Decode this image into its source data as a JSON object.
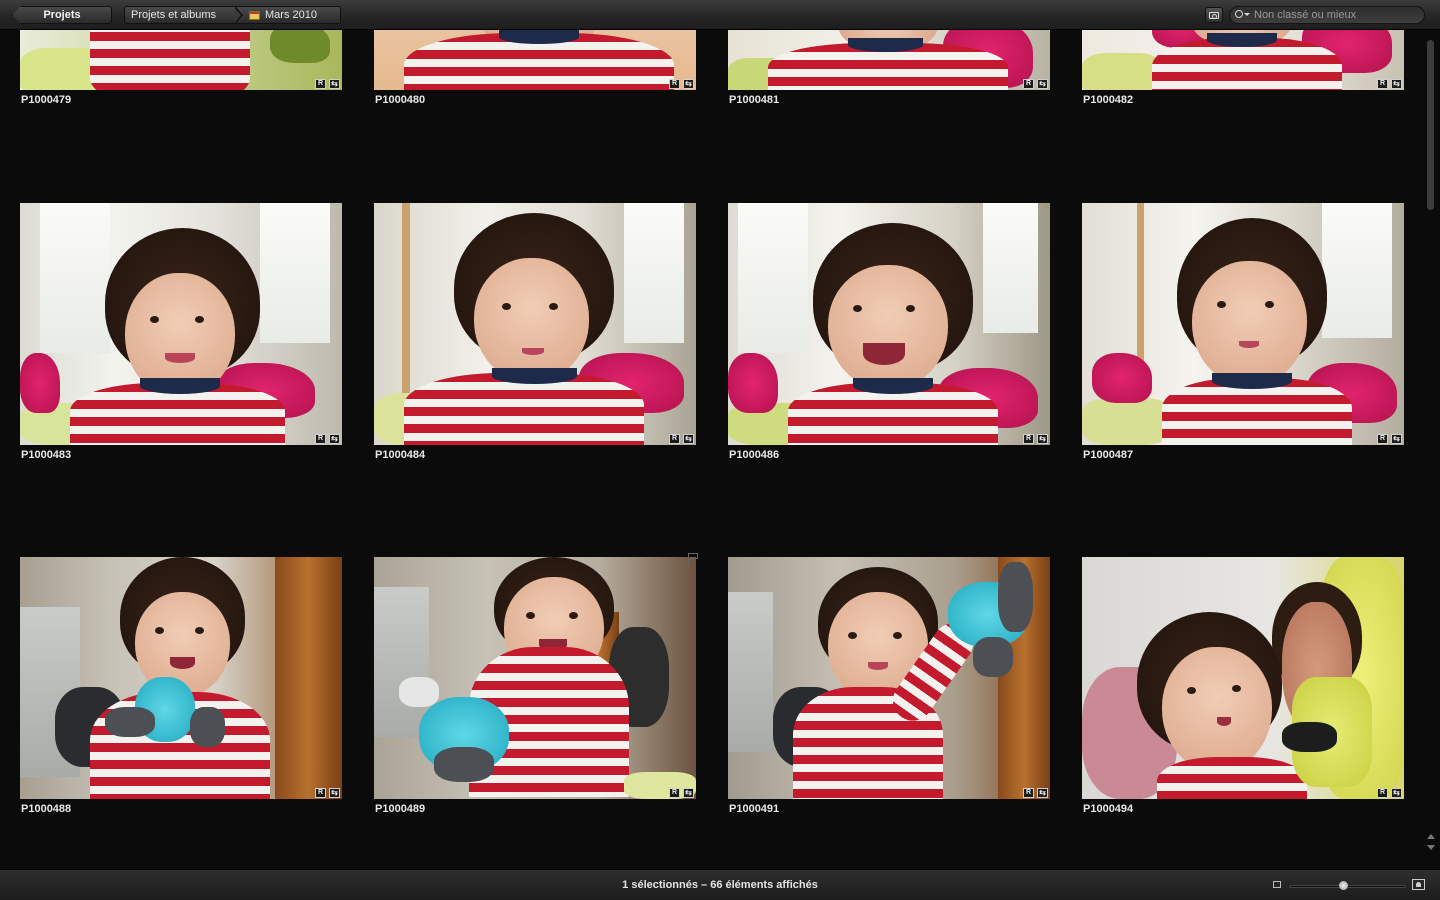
{
  "toolbar": {
    "back_label": "Projets",
    "breadcrumb": [
      "Projets et albums",
      "Mars 2010"
    ],
    "search_placeholder": "Non classé ou mieux"
  },
  "badges": {
    "raw": "R",
    "adjust": "⇆"
  },
  "photos": [
    {
      "name": "P1000479"
    },
    {
      "name": "P1000480"
    },
    {
      "name": "P1000481"
    },
    {
      "name": "P1000482"
    },
    {
      "name": "P1000483"
    },
    {
      "name": "P1000484"
    },
    {
      "name": "P1000486"
    },
    {
      "name": "P1000487"
    },
    {
      "name": "P1000488"
    },
    {
      "name": "P1000489"
    },
    {
      "name": "P1000491"
    },
    {
      "name": "P1000494"
    }
  ],
  "status": {
    "text": "1 sélectionnés – 66 éléments affichés"
  },
  "zoom": {
    "level": 0.46
  },
  "colors": {
    "background": "#0b0b0b",
    "shirt_red": "#c41a2e",
    "bed_pink": "#e2246d"
  }
}
